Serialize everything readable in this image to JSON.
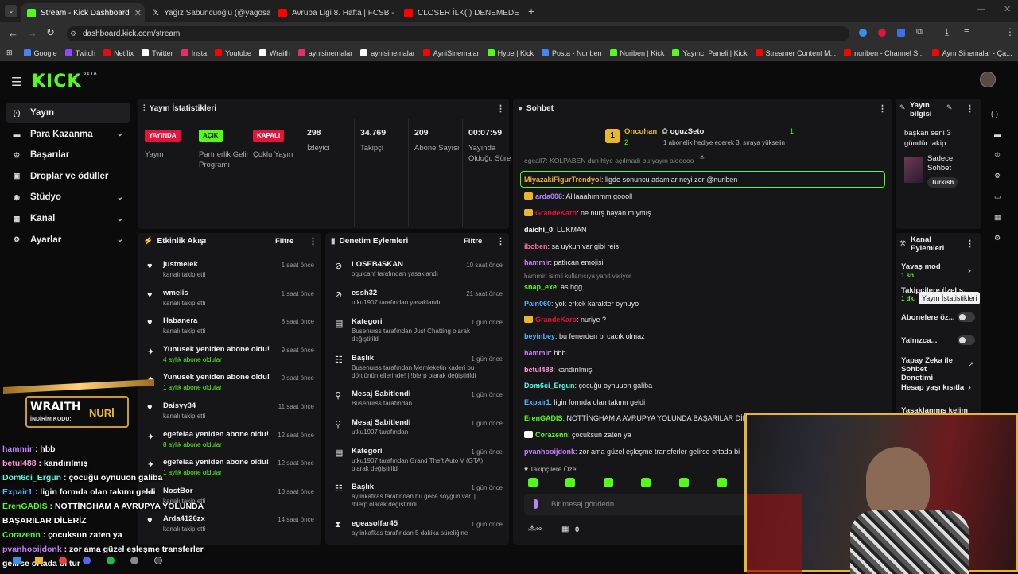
{
  "browser": {
    "tabs": [
      {
        "label": "Stream - Kick Dashboard",
        "color": "#53fc18"
      },
      {
        "label": "Yağız Sabuncuoğlu (@yagosab",
        "color": "#ffffff"
      },
      {
        "label": "Avrupa Ligi 8. Hafta | FCSB - Fe",
        "color": "#ff0000"
      },
      {
        "label": "CLOSER İLK(!) DENEMEDE BAŞAI",
        "color": "#ff0000"
      }
    ],
    "url": "dashboard.kick.com/stream",
    "bookmarks": [
      "Google",
      "Twitch",
      "Netflix",
      "Twitter",
      "Insta",
      "Youtube",
      "Wraith",
      "aynisinemalar",
      "aynisinemalar",
      "AyniSinemalar",
      "Hype | Kick",
      "Posta - Nuriben",
      "Nuriben | Kick",
      "Yayıncı Paneli | Kick",
      "Streamer Content M...",
      "nuriben - Channel S...",
      "Aynı Sinemalar - Ça..."
    ]
  },
  "brand": {
    "logo": "KICK",
    "beta": "BETA"
  },
  "nav": [
    {
      "label": "Yayın",
      "icon": "broadcast-icon"
    },
    {
      "label": "Para Kazanma",
      "icon": "money-icon"
    },
    {
      "label": "Başarılar",
      "icon": "trophy-icon"
    },
    {
      "label": "Droplar ve ödüller",
      "icon": "gift-icon"
    },
    {
      "label": "Stüdyo",
      "icon": "studio-icon"
    },
    {
      "label": "Kanal",
      "icon": "channel-icon"
    },
    {
      "label": "Ayarlar",
      "icon": "gear-icon"
    }
  ],
  "stats": {
    "title": "Yayın İstatistikleri",
    "items": [
      {
        "tag": "YAYINDA",
        "label": "Yayın",
        "color": "#e3143a"
      },
      {
        "tag": "AÇIK",
        "label": "Partnerlik Gelir Programı",
        "color": "#53fc18"
      },
      {
        "tag": "KAPALI",
        "label": "Çoklu Yayın",
        "color": "#e3143a"
      },
      {
        "value": "298",
        "label": "İzleyici"
      },
      {
        "value": "34.769",
        "label": "Takipçi"
      },
      {
        "value": "209",
        "label": "Abone Sayısı"
      },
      {
        "value": "00:07:59",
        "label": "Yayında Olduğu Süre"
      }
    ]
  },
  "activity": {
    "title": "Etkinlik Akışı",
    "filter": "Filtre",
    "items": [
      {
        "name": "justmelek",
        "sub": "kanalı takip etti",
        "time": "1 saat önce",
        "icon": "♥"
      },
      {
        "name": "wmelis",
        "sub": "kanalı takip etti",
        "time": "1 saat önce",
        "icon": "♥"
      },
      {
        "name": "Habanera",
        "sub": "kanalı takip etti",
        "time": "8 saat önce",
        "icon": "♥"
      },
      {
        "name": "Yunusek yeniden abone oldu!",
        "sub": "4 aylık abone oldular",
        "time": "9 saat önce",
        "icon": "✦"
      },
      {
        "name": "Yunusek yeniden abone oldu!",
        "sub": "1 aylık abone oldular",
        "time": "9 saat önce",
        "icon": "✦"
      },
      {
        "name": "Daisyy34",
        "sub": "kanalı takip etti",
        "time": "11 saat önce",
        "icon": "♥"
      },
      {
        "name": "egefelaa yeniden abone oldu!",
        "sub": "8 aylık abone oldular",
        "time": "12 saat önce",
        "icon": "✦"
      },
      {
        "name": "egefelaa yeniden abone oldu!",
        "sub": "1 aylık abone oldular",
        "time": "12 saat önce",
        "icon": "✦"
      },
      {
        "name": "NostBor",
        "sub": "kanalı takip etti",
        "time": "13 saat önce",
        "icon": "♥"
      },
      {
        "name": "Arda4126zx",
        "sub": "kanalı takip etti",
        "time": "14 saat önce",
        "icon": "♥"
      }
    ]
  },
  "moderation": {
    "title": "Denetim Eylemleri",
    "filter": "Filtre",
    "items": [
      {
        "name": "LOSEB4SKAN",
        "sub": "ogulcanf tarafından yasaklandı",
        "time": "10 saat önce",
        "icon": "⊘"
      },
      {
        "name": "essh32",
        "sub": "utku1907 tarafından yasaklandı",
        "time": "21 saat önce",
        "icon": "⊘"
      },
      {
        "name": "Kategori",
        "sub": "Busenurss tarafından Just Chatting olarak değiştirildi",
        "time": "1 gün önce",
        "icon": "▤"
      },
      {
        "name": "Başlık",
        "sub": "Busenurss tarafından Memleketin kaderi bu dörtlünün ellerinde! | !blerp olarak değiştirildi",
        "time": "1 gün önce",
        "icon": "☷"
      },
      {
        "name": "Mesaj Sabitlendi",
        "sub": "Busenurss tarafından",
        "time": "1 gün önce",
        "icon": "⚲"
      },
      {
        "name": "Mesaj Sabitlendi",
        "sub": "utku1907 tarafından",
        "time": "1 gün önce",
        "icon": "⚲"
      },
      {
        "name": "Kategori",
        "sub": "utku1907 tarafından Grand Theft Auto V (GTA) olarak değiştirildi",
        "time": "1 gün önce",
        "icon": "▤"
      },
      {
        "name": "Başlık",
        "sub": "aylinkafkas tarafından bu gece soygun var. | !blerp olarak değiştirildi",
        "time": "1 gün önce",
        "icon": "☷"
      },
      {
        "name": "egeasolfar45",
        "sub": "aylinkafkas tarafından 5 dakika süreliğine",
        "time": "1 gün önce",
        "icon": "⧗"
      }
    ]
  },
  "chat": {
    "title": "Sohbet",
    "leader": {
      "name": "Oncuhan",
      "count": "2",
      "gifter": "oguzSeto",
      "gifter_count": "1",
      "note": "1 abonelik hediye ederek 3. sıraya yükselin"
    },
    "pinned_partial": "egeall7: KOLPABEN dun hiye açılmadı bu yayın alooooo",
    "messages": [
      {
        "user": "MiyazakiFigurTrendyol",
        "text": "ligde sonuncu adamlar neyi zor @nuriben",
        "color": "#e8b82a"
      },
      {
        "user": "arda006",
        "text": "Alllaaahımmm goooll",
        "color": "#b388ff"
      },
      {
        "user": "GrandeKaro",
        "text": "ne nurş bayan mıymış",
        "color": "#e3143a"
      },
      {
        "user": "daichi_0",
        "text": "LUKMAN",
        "color": "#ffffff"
      },
      {
        "user": "iboben",
        "text": "sa uykun var gibi reis",
        "color": "#ff6b9a"
      },
      {
        "user": "hammir",
        "text": "patlıcan emojisi",
        "color": "#c77dff"
      },
      {
        "user": "snap_exe",
        "text": "as hgg",
        "color": "#53fc18",
        "reply": "hammir: isimli kullanıcıya yanıt veriyor"
      },
      {
        "user": "Pain060",
        "text": "yok erkek karakter oynuyo",
        "color": "#53b3fc"
      },
      {
        "user": "GrandeKaro",
        "text": "nuriye ?",
        "color": "#e3143a"
      },
      {
        "user": "beyinbey",
        "text": "bu fenerden bi cacık olmaz",
        "color": "#53b3fc"
      },
      {
        "user": "hammir",
        "text": "hbb",
        "color": "#c77dff"
      },
      {
        "user": "betul488",
        "text": "kandırılmış",
        "color": "#ff9ad5"
      },
      {
        "user": "Dom6ci_Ergun",
        "text": "çocuğu oynuuon galiba",
        "color": "#53fce0"
      },
      {
        "user": "Expair1",
        "text": "ligin formda olan takımı geldi",
        "color": "#53b3fc"
      },
      {
        "user": "ErenGADIS",
        "text": "NOTTİNGHAM A AVRUPYA YOLUNDA BAŞARILAR DİLE",
        "color": "#53fc18"
      },
      {
        "user": "Corazenn",
        "text": "çocuksun zaten ya",
        "color": "#53fc18"
      },
      {
        "user": "pvanhooijdonk",
        "text": "zor ama güzel eşleşme transferler gelirse ortada bi",
        "color": "#c77dff"
      }
    ],
    "followers_only": "Takipçilere Özel",
    "input_placeholder": "Bir mesaj gönderin",
    "points": "0"
  },
  "stream_info": {
    "title": "Yayın bilgisi",
    "stream_title": "başkan seni 3 gündür takip...",
    "category": "Sadece Sohbet",
    "language": "Turkish"
  },
  "channel_actions": {
    "title": "Kanal Eylemleri",
    "slow_mode": "Yavaş mod",
    "slow_val": "1 sn.",
    "followers_mode": "Takipçilere özel s...",
    "followers_val": "1 dk.",
    "tooltip": "Yayın İstatistikleri",
    "subs_only": "Abonelere öz...",
    "alone": "Yalnızca...",
    "ai": "Yapay Zeka ile Sohbet Denetimi",
    "age": "Hesap yaşı kısıtla",
    "banned": "Yasaklanmış kelim"
  },
  "overlay": {
    "promo": "WRAITH",
    "promo_sub": "İNDİRİM KODU:",
    "promo_code": "NURİ",
    "chat": [
      {
        "user": "hammir",
        "text": "hbb",
        "color": "#c77dff"
      },
      {
        "user": "betul488",
        "text": "kandırılmış",
        "color": "#ff9ad5"
      },
      {
        "user": "Dom6ci_Ergun",
        "text": "çocuğu oynuuon galiba",
        "color": "#53fce0"
      },
      {
        "user": "Expair1",
        "text": "ligin formda olan takımı geldi",
        "color": "#53b3fc"
      },
      {
        "user": "ErenGADIS",
        "text": "NOTTİNGHAM A AVRUPYA YOLUNDA",
        "color": "#53fc18"
      },
      {
        "user": "",
        "text": "BAŞARILAR DİLERİZ",
        "color": "#ffffff"
      },
      {
        "user": "Corazenn",
        "text": "çocuksun zaten ya",
        "color": "#53fc18"
      },
      {
        "user": "pvanhooijdonk",
        "text": "zor ama güzel eşleşme transferler",
        "color": "#c77dff"
      },
      {
        "user": "",
        "text": "gelirse ortada bi tur",
        "color": "#ffffff"
      }
    ]
  }
}
